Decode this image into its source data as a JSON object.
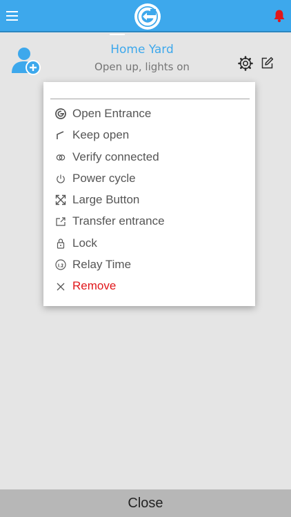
{
  "header": {
    "menu_icon": "hamburger-icon",
    "logo_icon": "gate-logo-icon",
    "notification_icon": "bell-icon",
    "accent_color": "#3da8ec",
    "alert_color": "#e0161a"
  },
  "gate": {
    "name": "Home Yard",
    "description": "Open up, lights on",
    "avatar_icon": "add-user-icon",
    "settings_icon": "gear-icon",
    "edit_icon": "edit-icon"
  },
  "menu": {
    "items": [
      {
        "label": "Open Entrance",
        "icon": "open-entrance-icon"
      },
      {
        "label": "Keep open",
        "icon": "keep-open-icon"
      },
      {
        "label": "Verify connected",
        "icon": "link-icon"
      },
      {
        "label": "Power cycle",
        "icon": "power-icon"
      },
      {
        "label": "Large Button",
        "icon": "expand-icon"
      },
      {
        "label": "Transfer entrance",
        "icon": "transfer-icon"
      },
      {
        "label": "Lock",
        "icon": "lock-icon"
      },
      {
        "label": "Relay Time",
        "icon": "relay-time-icon"
      },
      {
        "label": "Remove",
        "icon": "close-icon"
      }
    ]
  },
  "footer": {
    "close_label": "Close"
  }
}
